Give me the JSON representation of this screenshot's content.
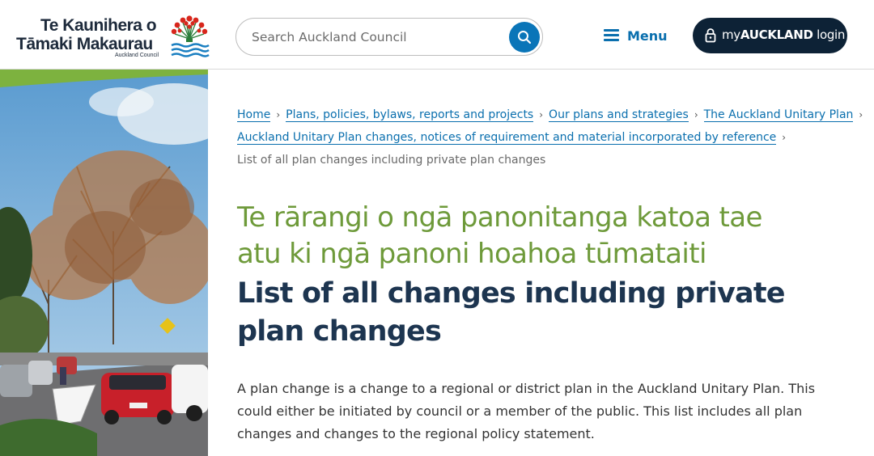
{
  "header": {
    "logo": {
      "line1": "Te Kaunihera o",
      "line2": "Tāmaki Makaurau",
      "sub": "Auckland Council"
    },
    "search": {
      "placeholder": "Search Auckland Council",
      "value": ""
    },
    "menu_label": "Menu",
    "login": {
      "prefix": "my",
      "brand": "AUCKLAND",
      "suffix": " login"
    }
  },
  "breadcrumb": {
    "items": [
      "Home",
      "Plans, policies, bylaws, reports and projects",
      "Our plans and strategies",
      "The Auckland Unitary Plan",
      "Auckland Unitary Plan changes, notices of requirement and material incorporated by reference"
    ],
    "current": "List of all plan changes including private plan changes"
  },
  "page": {
    "title_maori": "Te rārangi o ngā panonitanga katoa tae atu ki ngā panoni hoahoa tūmataiti",
    "title_english": "List of all changes including private plan changes",
    "intro": "A plan change is a change to a regional or district plan in the Auckland Unitary Plan. This could either be initiated by council or a member of the public. This list includes all plan changes and changes to the regional policy statement."
  },
  "colors": {
    "accent_blue": "#0a75b8",
    "dark_navy": "#0d2236",
    "title_green": "#6e9a3a",
    "title_navy": "#1d3550",
    "pohutukawa_red": "#d8261c"
  }
}
